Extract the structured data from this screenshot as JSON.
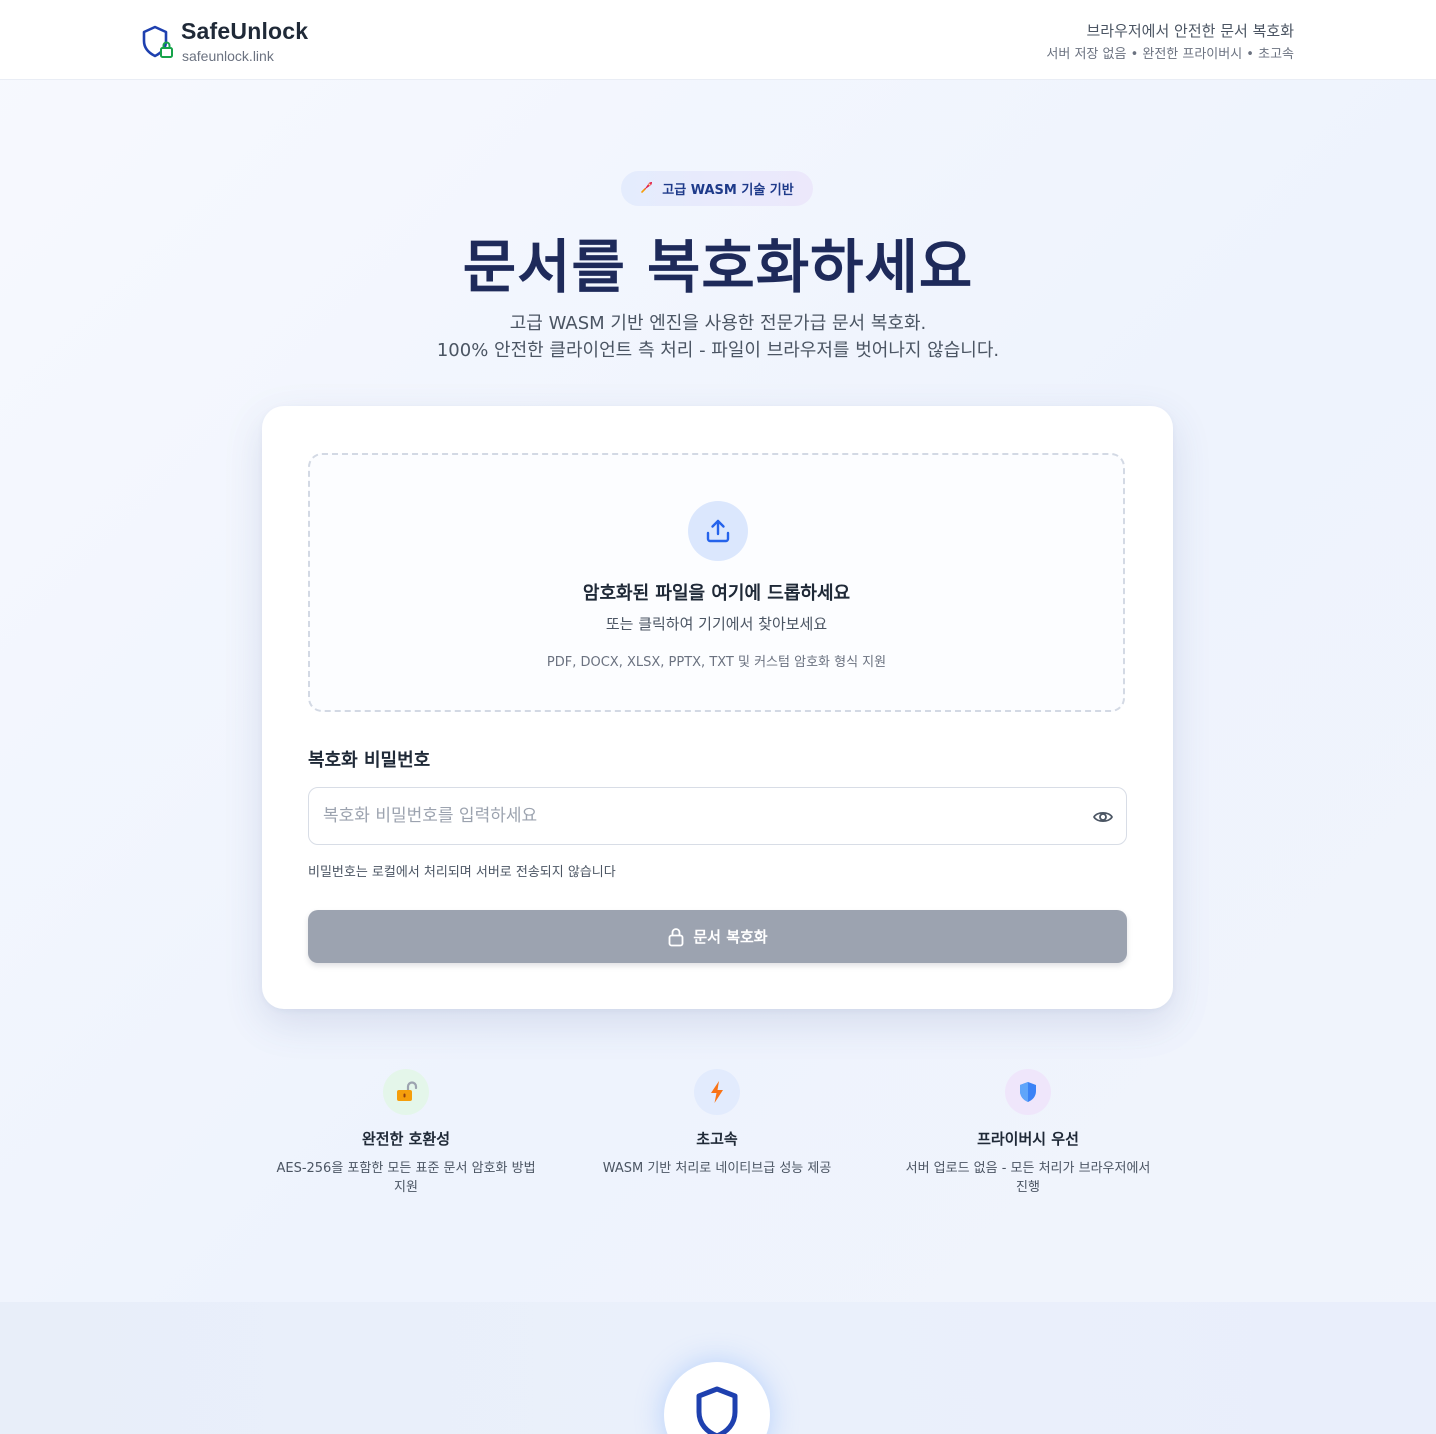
{
  "header": {
    "brand_name": "SafeUnlock",
    "brand_url": "safeunlock.link",
    "tagline": "브라우저에서 안전한 문서 복호화",
    "features": "서버 저장 없음 • 완전한 프라이버시 • 초고속"
  },
  "hero": {
    "badge_icon": "rocket-icon",
    "badge_text": "고급 WASM 기술 기반",
    "title": "문서를 복호화하세요",
    "subtitle_line1": "고급 WASM 기반 엔진을 사용한 전문가급 문서 복호화.",
    "subtitle_line2": "100% 안전한 클라이언트 측 처리 - 파일이 브라우저를 벗어나지 않습니다."
  },
  "upload": {
    "icon": "upload-icon",
    "title": "암호화된 파일을 여기에 드롭하세요",
    "subtitle": "또는 클릭하여 기기에서 찾아보세요",
    "formats": "PDF, DOCX, XLSX, PPTX, TXT 및 커스텀 암호화 형식 지원"
  },
  "password": {
    "label": "복호화 비밀번호",
    "placeholder": "복호화 비밀번호를 입력하세요",
    "value": "",
    "hint": "비밀번호는 로컬에서 처리되며 서버로 전송되지 않습니다"
  },
  "decrypt_button": {
    "label": "문서 복호화",
    "icon": "lock-icon"
  },
  "features": [
    {
      "icon": "unlocked-padlock-icon",
      "title": "완전한 호환성",
      "description": "AES-256을 포함한 모든 표준 문서 암호화 방법 지원"
    },
    {
      "icon": "lightning-icon",
      "title": "초고속",
      "description": "WASM 기반 처리로 네이티브급 성능 제공"
    },
    {
      "icon": "shield-icon",
      "title": "프라이버시 우선",
      "description": "서버 업로드 없음 - 모든 처리가 브라우저에서 진행"
    }
  ],
  "colors": {
    "title": "#1e2a5a",
    "badge_text": "#1e3a8a",
    "button_disabled": "#9ca3b0",
    "upload_circle": "#dbe7fd",
    "logo": "#1e40af"
  }
}
